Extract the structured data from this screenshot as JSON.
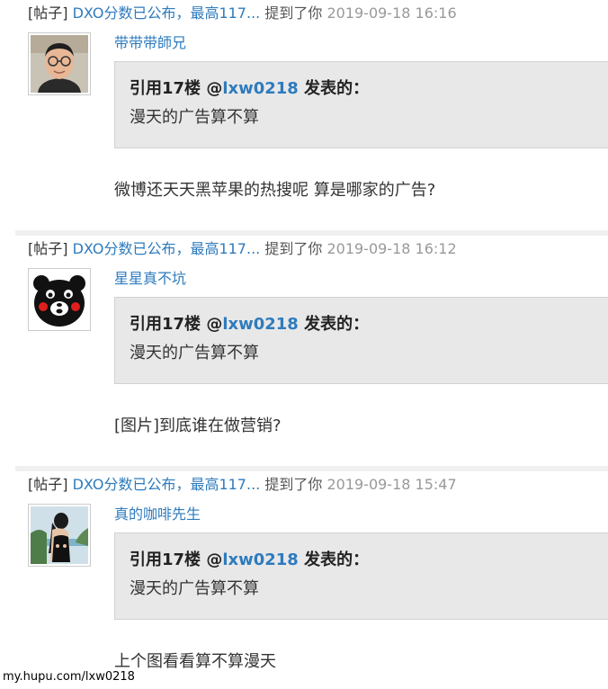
{
  "notifications": [
    {
      "tag": "[帖子]",
      "post_title": "DXO分数已公布，最高117...",
      "mention_text": "提到了你",
      "time": "2019-09-18 16:16",
      "username": "带带带師兄",
      "quote_prefix": "引用17楼 @",
      "quote_user": "lxw0218",
      "quote_suffix": " 发表的：",
      "quote_body": "漫天的广告算不算",
      "content": "微博还天天黑苹果的热搜呢 算是哪家的广告?"
    },
    {
      "tag": "[帖子]",
      "post_title": "DXO分数已公布，最高117...",
      "mention_text": "提到了你",
      "time": "2019-09-18 16:12",
      "username": "星星真不坑",
      "quote_prefix": "引用17楼 @",
      "quote_user": "lxw0218",
      "quote_suffix": " 发表的：",
      "quote_body": "漫天的广告算不算",
      "content": "[图片]到底谁在做营销?"
    },
    {
      "tag": "[帖子]",
      "post_title": "DXO分数已公布，最高117...",
      "mention_text": "提到了你",
      "time": "2019-09-18 15:47",
      "username": "真的咖啡先生",
      "quote_prefix": "引用17楼 @",
      "quote_user": "lxw0218",
      "quote_suffix": " 发表的：",
      "quote_body": "漫天的广告算不算",
      "content": "上个图看看算不算漫天"
    }
  ],
  "avatars": [
    "avatar-man-glasses",
    "avatar-kumamon",
    "avatar-woman-swimsuit"
  ],
  "watermark": "my.hupu.com/lxw0218",
  "colors": {
    "link": "#2e7bbd",
    "time": "#999999",
    "quote_bg": "#e8e8e8",
    "divider": "#f0f0f0"
  }
}
